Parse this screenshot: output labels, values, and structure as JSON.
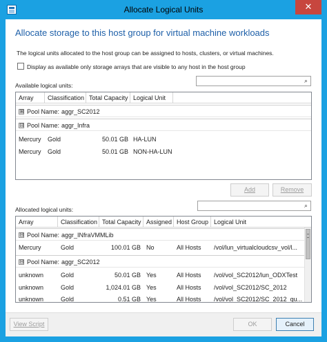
{
  "window": {
    "title": "Allocate Logical Units",
    "close_glyph": "✕"
  },
  "heading": "Allocate storage to this host group for virtual machine workloads",
  "description": "The logical units allocated to the host group can be assigned to hosts, clusters, or virtual machines.",
  "checkbox": {
    "label": "Display as available only storage arrays that are visible to any host in the host group",
    "checked": false
  },
  "available": {
    "label": "Available logical units:",
    "search_placeholder": "",
    "columns": [
      "Array",
      "Classification",
      "Total Capacity",
      "Logical Unit"
    ],
    "groups": [
      {
        "expander": "⊞",
        "prefix": "Pool Name:",
        "name": "aggr_SC2012",
        "expanded": false,
        "rows": []
      },
      {
        "expander": "⊟",
        "prefix": "Pool Name:",
        "name": "aggr_Infra",
        "expanded": true,
        "rows": [
          {
            "array": "Mercury",
            "classification": "Gold",
            "capacity": "50.01 GB",
            "lun": "HA-LUN"
          },
          {
            "array": "Mercury",
            "classification": "Gold",
            "capacity": "50.01 GB",
            "lun": "NON-HA-LUN"
          }
        ]
      }
    ]
  },
  "buttons": {
    "add": "Add",
    "remove": "Remove",
    "view_script": "View Script",
    "ok": "OK",
    "cancel": "Cancel"
  },
  "allocated": {
    "label": "Allocated logical units:",
    "search_placeholder": "",
    "columns": [
      "Array",
      "Classification",
      "Total Capacity",
      "Assigned",
      "Host Group",
      "Logical Unit"
    ],
    "groups": [
      {
        "expander": "⊟",
        "prefix": "Pool Name:",
        "name": "aggr_INfraVMMLib",
        "rows": [
          {
            "array": "Mercury",
            "classification": "Gold",
            "capacity": "100.01 GB",
            "assigned": "No",
            "host_group": "All Hosts",
            "lun": "/vol/lun_virtualcloudcsv_vol/l..."
          }
        ]
      },
      {
        "expander": "⊟",
        "prefix": "Pool Name:",
        "name": "aggr_SC2012",
        "rows": [
          {
            "array": "unknown",
            "classification": "Gold",
            "capacity": "50.01 GB",
            "assigned": "Yes",
            "host_group": "All Hosts",
            "lun": "/vol/vol_SC2012/lun_ODXTest"
          },
          {
            "array": "unknown",
            "classification": "Gold",
            "capacity": "1,024.01 GB",
            "assigned": "Yes",
            "host_group": "All Hosts",
            "lun": "/vol/vol_SC2012/SC_2012"
          },
          {
            "array": "unknown",
            "classification": "Gold",
            "capacity": "0.51 GB",
            "assigned": "Yes",
            "host_group": "All Hosts",
            "lun": "/vol/vol_SC2012/SC_2012_qu..."
          }
        ]
      }
    ]
  },
  "colors": {
    "titlebar": "#1ba1e2",
    "heading": "#1d5fa8",
    "close": "#c7463e"
  },
  "icons": {
    "search": "search-icon",
    "app": "storage-app-icon"
  }
}
